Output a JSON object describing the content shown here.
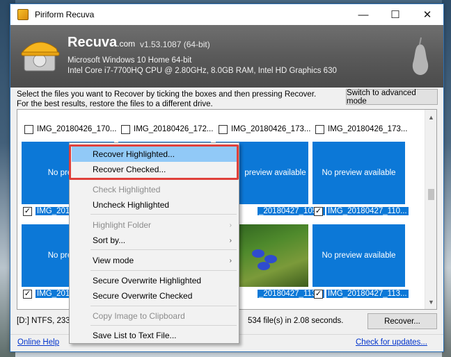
{
  "window": {
    "title": "Piriform Recuva",
    "controls": {
      "minimize": "—",
      "maximize": "☐",
      "close": "✕"
    }
  },
  "header": {
    "brand": "Recuva",
    "brand_suffix": ".com",
    "version": "v1.53.1087 (64-bit)",
    "os_line": "Microsoft Windows 10 Home 64-bit",
    "hw_line": "Intel Core i7-7700HQ CPU @ 2.80GHz, 8.0GB RAM, Intel HD Graphics 630"
  },
  "instructions": {
    "line1": "Select the files you want to Recover by ticking the boxes and then pressing Recover.",
    "line2": "For the best results, restore the files to a different drive."
  },
  "advanced_button": "Switch to advanced mode",
  "grid": {
    "row1": [
      {
        "name": "IMG_20180426_170...",
        "checked": false
      },
      {
        "name": "IMG_20180426_172...",
        "checked": false
      },
      {
        "name": "IMG_20180426_173...",
        "checked": false
      },
      {
        "name": "IMG_20180426_173...",
        "checked": false
      }
    ],
    "row2": [
      {
        "name": "IMG_2018",
        "preview": "No preview",
        "checked": true
      },
      {
        "name": "",
        "preview": "",
        "checked": true
      },
      {
        "name": "_20180427_105...",
        "preview": "preview available",
        "checked": true
      },
      {
        "name": "IMG_20180427_110...",
        "preview": "No preview available",
        "checked": true
      }
    ],
    "row3": [
      {
        "name": "IMG_2018",
        "preview": "No preview",
        "checked": true
      },
      {
        "name": "",
        "preview": "",
        "checked": true
      },
      {
        "name": "_20180427_113...",
        "preview": "",
        "checked": true
      },
      {
        "name": "IMG_20180427_113...",
        "preview": "No preview available",
        "checked": true
      }
    ],
    "check_mark": "✓"
  },
  "status": {
    "left": "[D:] NTFS, 233",
    "right": "534 file(s) in 2.08 seconds."
  },
  "recover_button": "Recover...",
  "footer": {
    "help_link": "Online Help",
    "updates_link": "Check for updates..."
  },
  "context_menu": {
    "items": [
      {
        "label": "Recover Highlighted...",
        "enabled": true,
        "highlighted": true
      },
      {
        "label": "Recover Checked...",
        "enabled": true
      },
      {
        "label": "Check Highlighted",
        "enabled": false
      },
      {
        "label": "Uncheck Highlighted",
        "enabled": true
      },
      {
        "label": "Highlight Folder",
        "enabled": false,
        "submenu": true
      },
      {
        "label": "Sort by...",
        "enabled": true,
        "submenu": true
      },
      {
        "label": "View mode",
        "enabled": true,
        "submenu": true
      },
      {
        "label": "Secure Overwrite Highlighted",
        "enabled": true
      },
      {
        "label": "Secure Overwrite Checked",
        "enabled": true
      },
      {
        "label": "Copy Image to Clipboard",
        "enabled": false
      },
      {
        "label": "Save List to Text File...",
        "enabled": true
      }
    ],
    "submenu_arrow": "›"
  },
  "scroll": {
    "up": "▲",
    "down": "▼"
  },
  "colors": {
    "accent": "#0c78d7",
    "menu_highlight": "#91c9f7",
    "callout": "#e0403a"
  },
  "icons": [
    "recuva-app-icon",
    "recuva-logo-icon",
    "pear-icon",
    "checkbox-icon",
    "submenu-arrow-icon"
  ]
}
